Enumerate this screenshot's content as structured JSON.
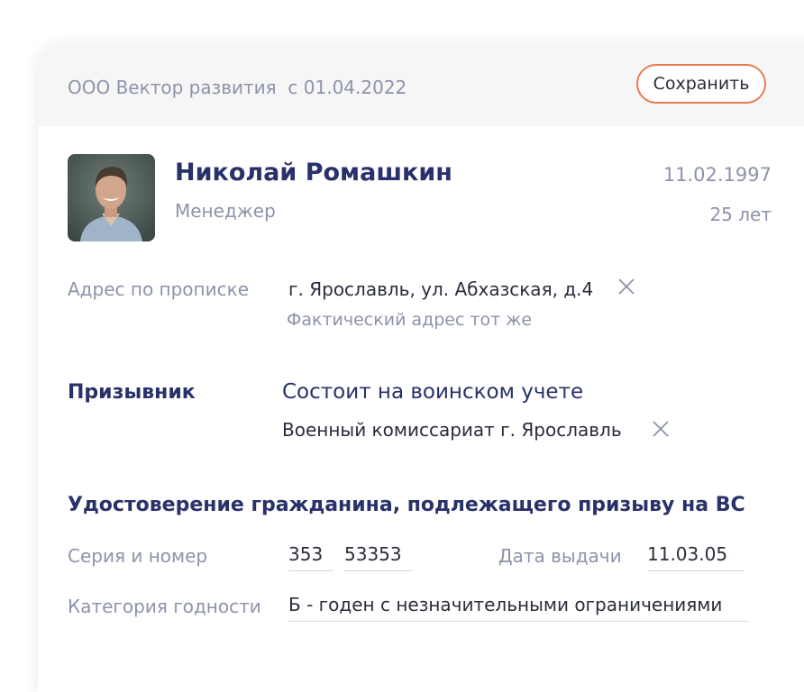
{
  "header": {
    "company": "ООО Вектор развития",
    "since": "с 01.04.2022",
    "save_label": "Сохранить"
  },
  "employee": {
    "name": "Николай Ромашкин",
    "position": "Менеджер",
    "birth_date": "11.02.1997",
    "age": "25 лет"
  },
  "address": {
    "label": "Адрес по прописке",
    "value": "г. Ярославль, ул. Абхазская, д.4",
    "actual_hint": "Фактический адрес тот же"
  },
  "military": {
    "label": "Призывник",
    "status": "Состоит на воинском учете",
    "office": "Военный комиссариат г. Ярославль"
  },
  "certificate": {
    "title": "Удостоверение гражданина, подлежащего призыву на ВС",
    "series_number_label": "Серия и номер",
    "series": "353",
    "number": "53353",
    "issue_date_label": "Дата выдачи",
    "issue_date": "11.03.05",
    "fitness_label": "Категория годности",
    "fitness_value": "Б - годен с незначительными ограничениями"
  },
  "colors": {
    "accent": "#ea7a52",
    "title": "#28316a",
    "muted": "#8d93a9"
  }
}
